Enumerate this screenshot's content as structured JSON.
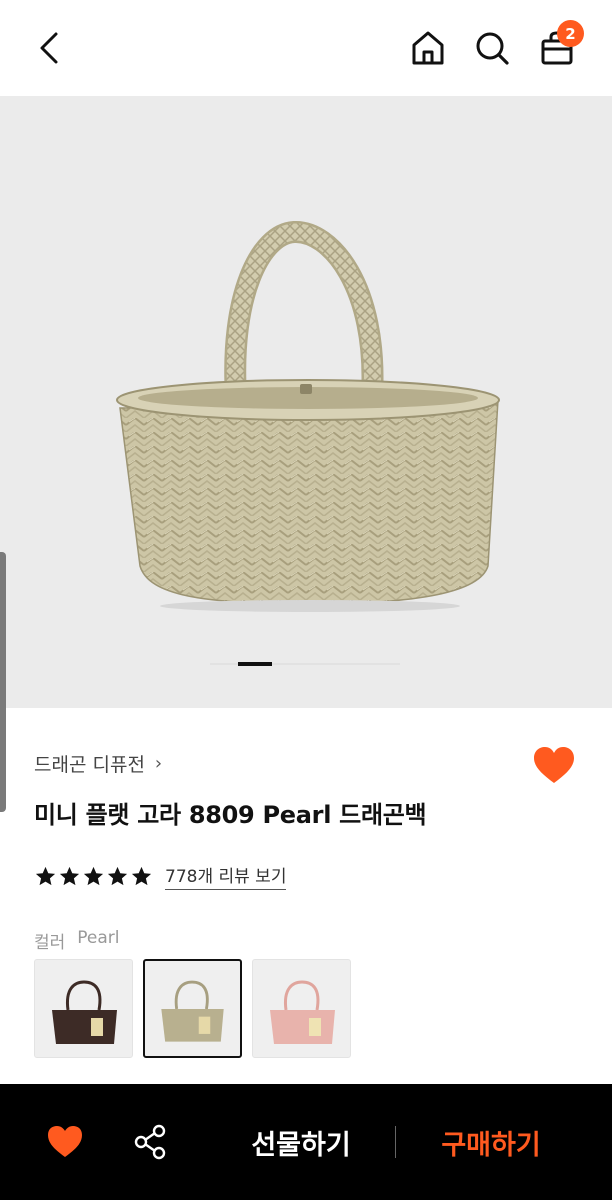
{
  "header": {
    "back_icon": "chevron-left-icon",
    "home_icon": "home-icon",
    "search_icon": "search-icon",
    "bag_icon": "shopping-bag-icon",
    "cart_count": "2"
  },
  "gallery": {
    "image": "woven basket bag, beige",
    "current_page": 1
  },
  "product": {
    "brand": "드래곤 디퓨전",
    "brand_chevron": "›",
    "title": "미니 플랫 고라 8809 Pearl 드래곤백",
    "rating_stars": 5,
    "review_link": "778개 리뷰 보기",
    "color_label": "컬러",
    "color_value": "Pearl",
    "swatches": [
      {
        "color": "#3d2b26",
        "selected": false
      },
      {
        "color": "#cbc3a4",
        "selected": true
      },
      {
        "color": "#e8b3ac",
        "selected": false
      }
    ]
  },
  "bottom_bar": {
    "gift_label": "선물하기",
    "buy_label": "구매하기",
    "heart_icon": "heart-icon",
    "share_icon": "share-icon"
  },
  "colors": {
    "accent": "#ff5a1f",
    "bar_bg": "#000000",
    "hero_bg": "#ebebeb"
  }
}
